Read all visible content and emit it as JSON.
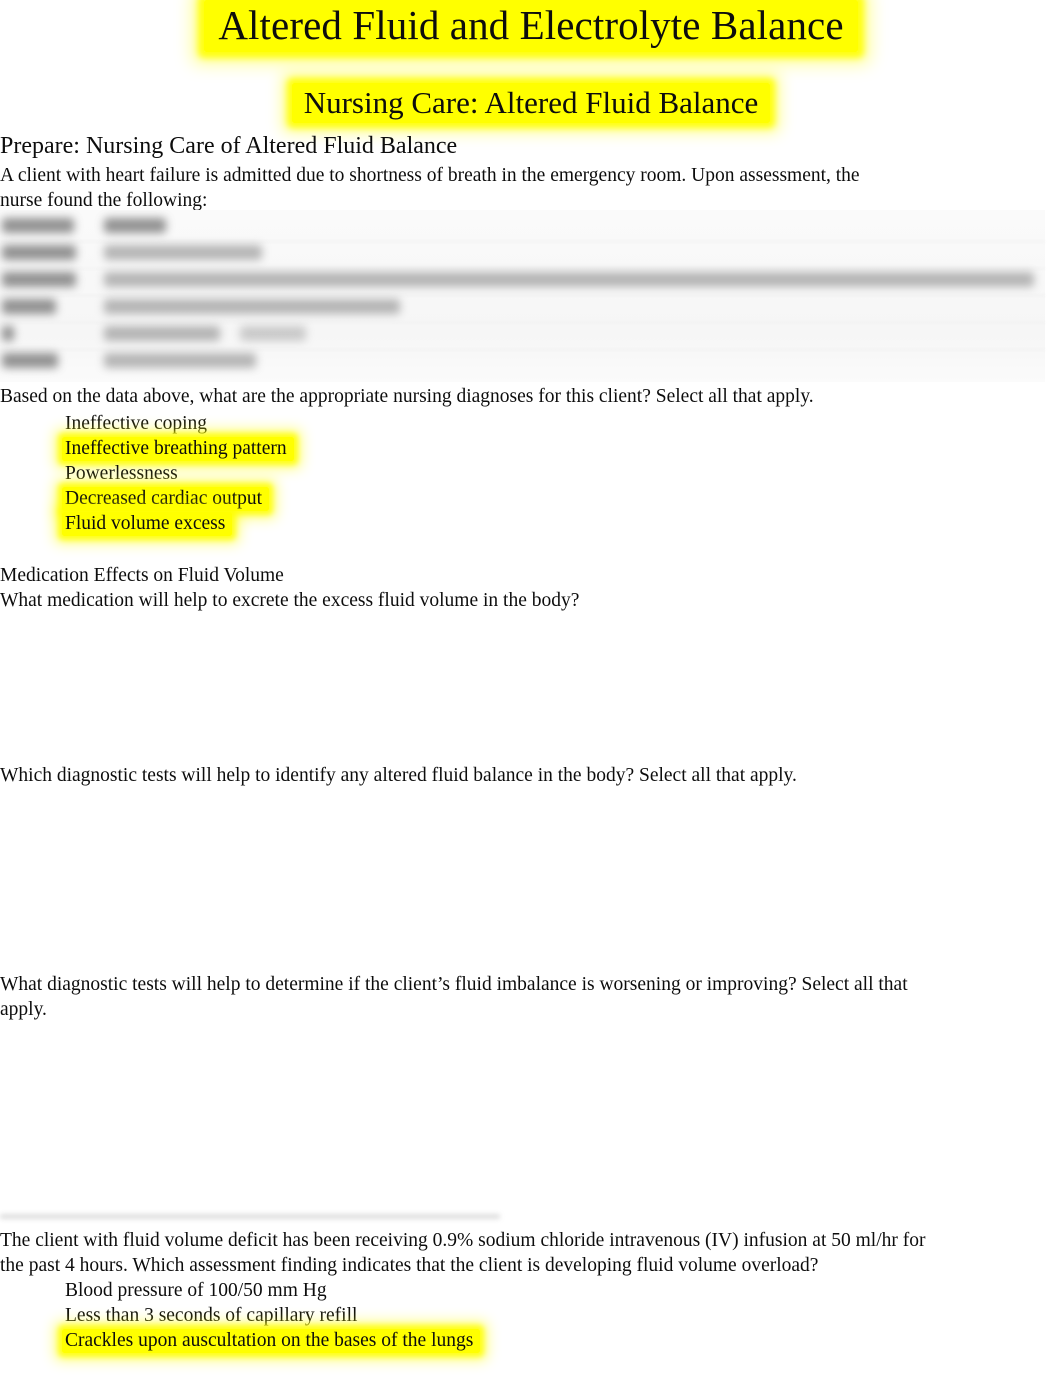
{
  "document": {
    "title": "Altered Fluid and Electrolyte Balance",
    "subtitle": "Nursing Care: Altered Fluid Balance",
    "highlight_color": "#ffff00",
    "text_color": "#0d0d0d",
    "background_color": "#ffffff"
  },
  "prepare_section": {
    "heading": "Prepare: Nursing Care of Altered Fluid Balance",
    "scenario": "A client with heart failure is admitted due to shortness of breath in the emergency room. Upon assessment, the nurse found the following:",
    "assessment_table": {
      "state": "blurred-redacted",
      "visible_header_hint": "Assessment / Finding",
      "column_count": 2,
      "row_count": 6,
      "background_color": "#f7f7f7",
      "note": "Table content is blurred and illegible in the source image."
    }
  },
  "question_1": {
    "prompt": "Based on the data above, what are the appropriate nursing diagnoses for this client? Select all that apply.",
    "options": [
      {
        "label": "Ineffective coping",
        "highlighted": false
      },
      {
        "label": "Ineffective breathing pattern",
        "highlighted": true
      },
      {
        "label": "Powerlessness",
        "highlighted": false
      },
      {
        "label": "Decreased cardiac output",
        "highlighted": true
      },
      {
        "label": "Fluid volume excess",
        "highlighted": true
      }
    ]
  },
  "medication_section": {
    "heading": "Medication Effects on Fluid Volume",
    "question": "What medication will help to excrete the excess fluid volume in the body?",
    "answer": ""
  },
  "question_2": {
    "prompt": "Which diagnostic tests will help to identify any altered fluid balance in the body? Select all that apply.",
    "answer": ""
  },
  "question_3": {
    "prompt": "What diagnostic tests will help to determine if the client’s fluid imbalance is worsening or improving? Select all that apply.",
    "answer": ""
  },
  "question_4": {
    "prompt": "The client with fluid volume deficit has been receiving 0.9% sodium chloride intravenous (IV) infusion at 50 ml/hr for the past 4 hours. Which assessment finding indicates that the client is developing fluid volume overload?",
    "options": [
      {
        "label": "Blood pressure of 100/50 mm Hg",
        "highlighted": false
      },
      {
        "label": "Less than 3 seconds of capillary refill",
        "highlighted": false
      },
      {
        "label": "Crackles upon auscultation on the bases of the lungs",
        "highlighted": true
      }
    ]
  }
}
